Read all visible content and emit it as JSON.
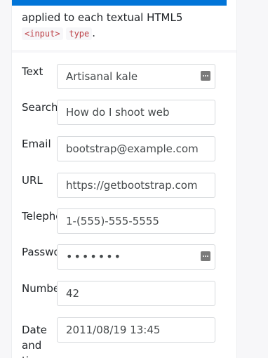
{
  "intro": {
    "text": "applied to each textual HTML5",
    "code1": "<input>",
    "code2": "type",
    "suffix": "."
  },
  "form": {
    "fields": [
      {
        "label": "Text",
        "value": "Artisanal kale",
        "has_menu_icon": true
      },
      {
        "label": "Search",
        "value": "How do I shoot web"
      },
      {
        "label": "Email",
        "value": "bootstrap@example.com"
      },
      {
        "label": "URL",
        "value": "https://getbootstrap.com"
      },
      {
        "label": "Telephone",
        "value": "1-(555)-555-5555"
      },
      {
        "label": "Password",
        "value": "•••••••",
        "has_menu_icon": true
      },
      {
        "label": "Number",
        "value": "42"
      },
      {
        "label": "Date and time",
        "value": "2011/08/19 13:45"
      }
    ]
  },
  "colors": {
    "accent": "#0275d8",
    "code_text": "#bd4147",
    "border": "#d6d9dc"
  },
  "icons": {
    "field_menu": "kebab-menu-icon"
  }
}
